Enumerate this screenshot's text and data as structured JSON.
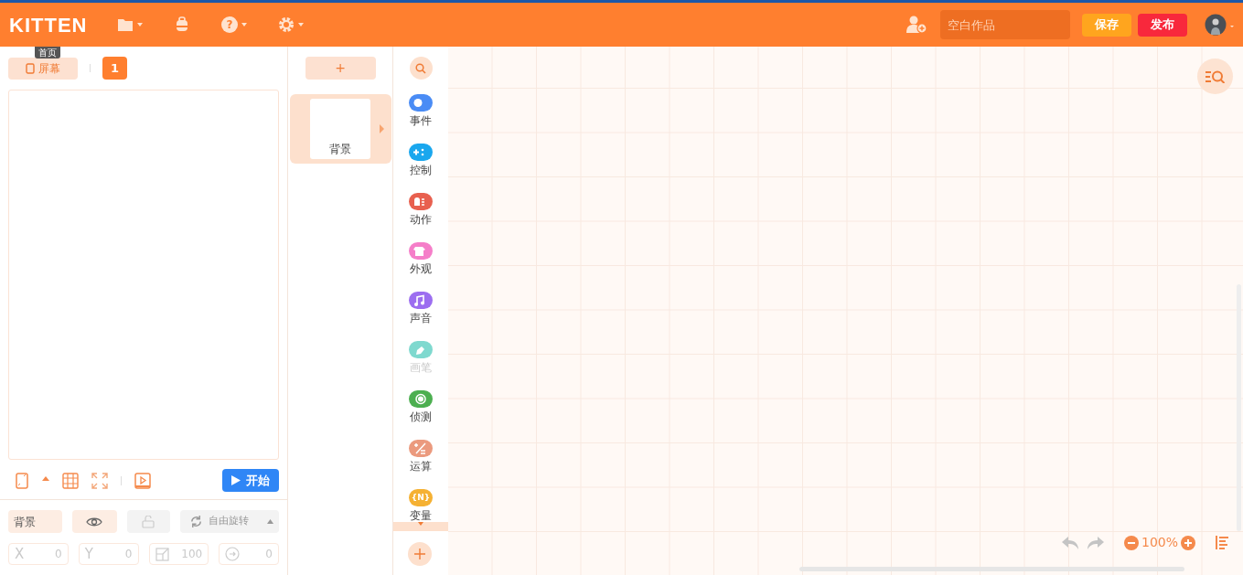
{
  "header": {
    "logo": "KITTEN",
    "project_name": {
      "placeholder": "空白作品"
    },
    "help_mark": "?",
    "save": "保存",
    "publish": "发布"
  },
  "tooltip": "首页",
  "stage": {
    "screen_button": "屏幕",
    "screen_count": "1",
    "start_button": "开始"
  },
  "sprite_props": {
    "name": "背景",
    "visible": true,
    "locked": false,
    "rotation_mode": "自由旋转",
    "fields": [
      {
        "kind": "x",
        "label": "X",
        "value": "0"
      },
      {
        "kind": "y",
        "label": "Y",
        "value": "0"
      },
      {
        "kind": "size",
        "value": "100"
      },
      {
        "kind": "rotation",
        "value": "0"
      }
    ]
  },
  "sprites": {
    "add": "+",
    "items": [
      {
        "name": "背景",
        "selected": true
      }
    ]
  },
  "categories": [
    {
      "kind": "event",
      "label": "事件",
      "color": "#4a8cf5",
      "disabled": false
    },
    {
      "kind": "control",
      "label": "控制",
      "color": "#1aa7ee",
      "disabled": false
    },
    {
      "kind": "action",
      "label": "动作",
      "color": "#e8604f",
      "disabled": false
    },
    {
      "kind": "look",
      "label": "外观",
      "color": "#f57ec9",
      "disabled": false
    },
    {
      "kind": "sound",
      "label": "声音",
      "color": "#9c6ef0",
      "disabled": false
    },
    {
      "kind": "pen",
      "label": "画笔",
      "color": "#7fd9cf",
      "disabled": true
    },
    {
      "kind": "sense",
      "label": "侦测",
      "color": "#4caf50",
      "disabled": false
    },
    {
      "kind": "operator",
      "label": "运算",
      "color": "#eb9a7e",
      "disabled": false
    },
    {
      "kind": "variable",
      "label": "变量",
      "color": "#f5b133",
      "disabled": false,
      "icon_text": "{N}"
    }
  ],
  "canvas": {
    "zoom": "100%"
  }
}
